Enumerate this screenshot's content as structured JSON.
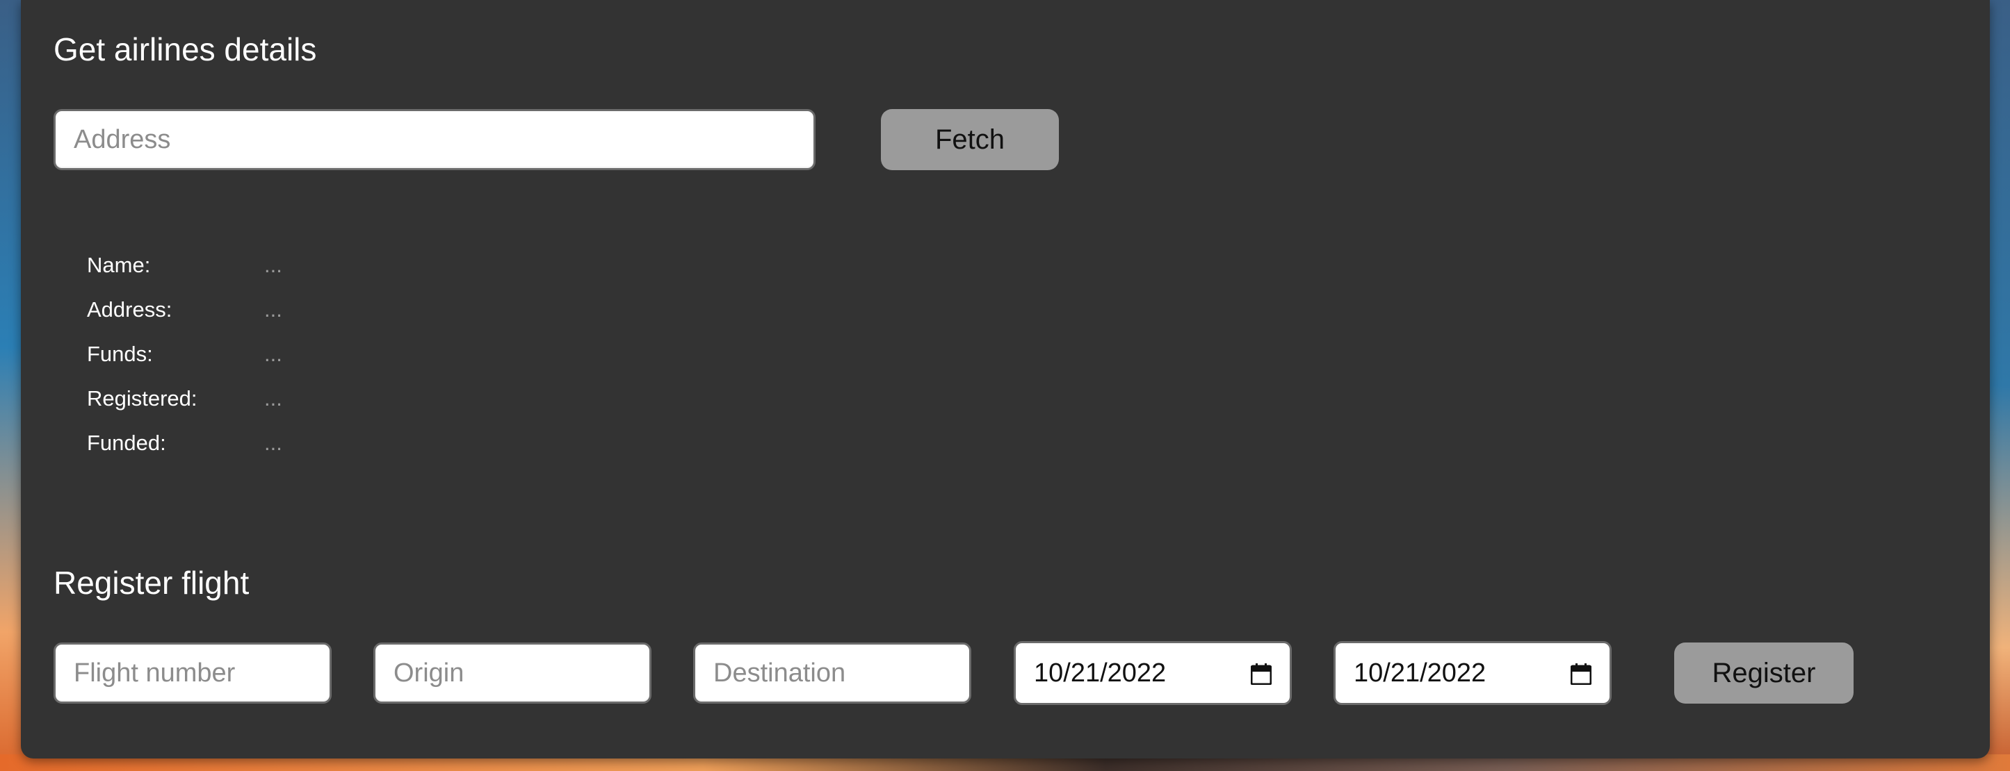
{
  "airline_section": {
    "title": "Get airlines details",
    "address_placeholder": "Address",
    "address_value": "",
    "fetch_label": "Fetch",
    "details": [
      {
        "label": "Name:",
        "value": "..."
      },
      {
        "label": "Address:",
        "value": "..."
      },
      {
        "label": "Funds:",
        "value": "..."
      },
      {
        "label": "Registered:",
        "value": "..."
      },
      {
        "label": "Funded:",
        "value": "..."
      }
    ]
  },
  "flight_section": {
    "title": "Register flight",
    "flight_number_placeholder": "Flight number",
    "origin_placeholder": "Origin",
    "destination_placeholder": "Destination",
    "departure_date": "10/21/2022",
    "arrival_date": "10/21/2022",
    "register_label": "Register"
  },
  "icons": {
    "date_picker": "calendar-icon"
  },
  "colors": {
    "card_background": "#333333",
    "button_background": "#9b9b9b",
    "text_light": "#ffffff",
    "value_muted": "#9a9a9a"
  }
}
